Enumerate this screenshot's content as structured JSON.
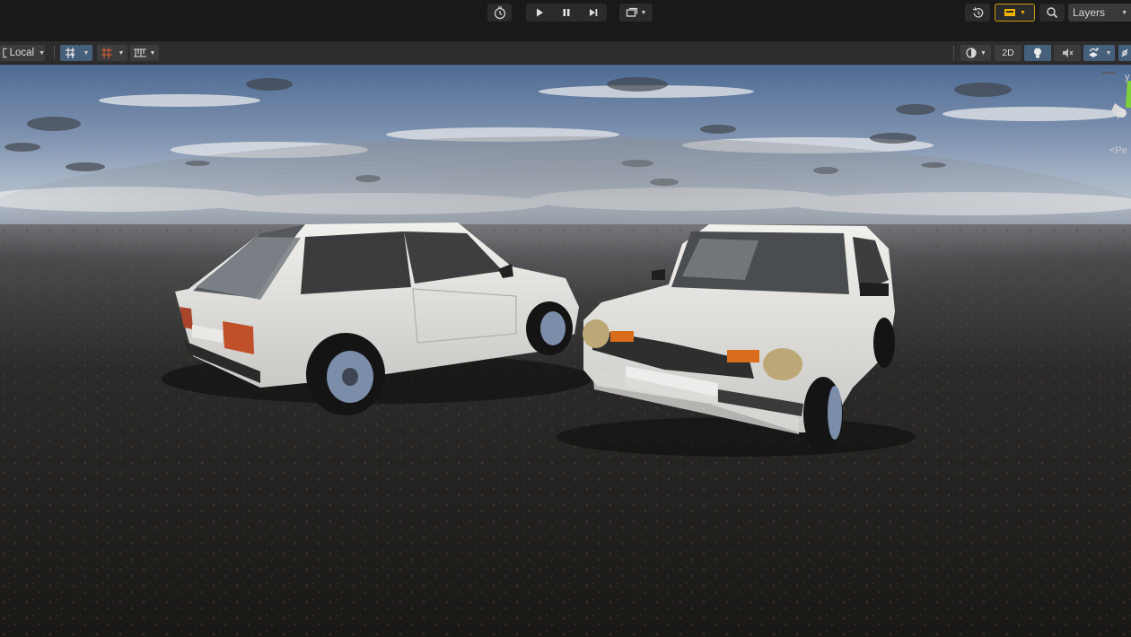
{
  "top_toolbar": {
    "history_icon": "history-icon",
    "play_icon": "play-icon",
    "pause_icon": "pause-icon",
    "step_icon": "step-icon",
    "layout_icon": "display-icon",
    "undo_history_icon": "undo-history-icon",
    "cloud_icon": "cloud-services-icon",
    "search_icon": "search-icon",
    "layers_label": "Layers"
  },
  "scene_toolbar": {
    "pivot_rotation_label": "Local",
    "two_d_label": "2D",
    "accent_color": "#46607c"
  },
  "viewport": {
    "gizmo_y_label": "y",
    "gizmo_persp_label": "<Pe"
  }
}
